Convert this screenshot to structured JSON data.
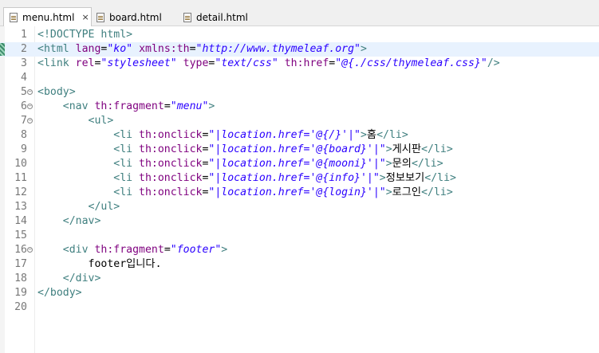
{
  "tabs": [
    {
      "label": "menu.html",
      "active": true,
      "close": "×"
    },
    {
      "label": "board.html",
      "active": false
    },
    {
      "label": "detail.html",
      "active": false
    }
  ],
  "colors": {
    "tag": "#3f7f7f",
    "attr": "#7f007f",
    "value": "#2a00ff",
    "text": "#000000",
    "line_number": "#787878",
    "highlight": "#e8f2fe"
  },
  "editor": {
    "lines": [
      {
        "n": "1",
        "fold": false,
        "segments": [
          [
            "t",
            "<!DOCTYPE html>"
          ]
        ]
      },
      {
        "n": "2",
        "fold": false,
        "segments": [
          [
            "t",
            "<html "
          ],
          [
            "a",
            "lang"
          ],
          [
            "x",
            "="
          ],
          [
            "v",
            "\"ko\""
          ],
          [
            "a",
            " xmlns:th"
          ],
          [
            "x",
            "="
          ],
          [
            "v",
            "\"http://www.thymeleaf.org\""
          ],
          [
            "t",
            ">"
          ]
        ]
      },
      {
        "n": "3",
        "fold": false,
        "segments": [
          [
            "t",
            "<link "
          ],
          [
            "a",
            "rel"
          ],
          [
            "x",
            "="
          ],
          [
            "v",
            "\"stylesheet\""
          ],
          [
            "a",
            " type"
          ],
          [
            "x",
            "="
          ],
          [
            "v",
            "\"text/css\""
          ],
          [
            "a",
            " th:href"
          ],
          [
            "x",
            "="
          ],
          [
            "v",
            "\"@{./css/thymeleaf.css}\""
          ],
          [
            "t",
            "/>"
          ]
        ]
      },
      {
        "n": "4",
        "fold": false,
        "segments": []
      },
      {
        "n": "5",
        "fold": true,
        "segments": [
          [
            "t",
            "<body>"
          ]
        ]
      },
      {
        "n": "6",
        "fold": true,
        "segments": [
          [
            "x",
            "    "
          ],
          [
            "t",
            "<nav "
          ],
          [
            "a",
            "th:fragment"
          ],
          [
            "x",
            "="
          ],
          [
            "v",
            "\"menu\""
          ],
          [
            "t",
            ">"
          ]
        ]
      },
      {
        "n": "7",
        "fold": true,
        "segments": [
          [
            "x",
            "        "
          ],
          [
            "t",
            "<ul>"
          ]
        ]
      },
      {
        "n": "8",
        "fold": false,
        "segments": [
          [
            "x",
            "            "
          ],
          [
            "t",
            "<li "
          ],
          [
            "a",
            "th:onclick"
          ],
          [
            "x",
            "="
          ],
          [
            "v",
            "\"|location.href='@{/}'|\""
          ],
          [
            "t",
            ">"
          ],
          [
            "b",
            "홈"
          ],
          [
            "t",
            "</li>"
          ]
        ]
      },
      {
        "n": "9",
        "fold": false,
        "segments": [
          [
            "x",
            "            "
          ],
          [
            "t",
            "<li "
          ],
          [
            "a",
            "th:onclick"
          ],
          [
            "x",
            "="
          ],
          [
            "v",
            "\"|location.href='@{board}'|\""
          ],
          [
            "t",
            ">"
          ],
          [
            "b",
            "게시판"
          ],
          [
            "t",
            "</li>"
          ]
        ]
      },
      {
        "n": "10",
        "fold": false,
        "segments": [
          [
            "x",
            "            "
          ],
          [
            "t",
            "<li "
          ],
          [
            "a",
            "th:onclick"
          ],
          [
            "x",
            "="
          ],
          [
            "v",
            "\"|location.href='@{mooni}'|\""
          ],
          [
            "t",
            ">"
          ],
          [
            "b",
            "문의"
          ],
          [
            "t",
            "</li>"
          ]
        ]
      },
      {
        "n": "11",
        "fold": false,
        "segments": [
          [
            "x",
            "            "
          ],
          [
            "t",
            "<li "
          ],
          [
            "a",
            "th:onclick"
          ],
          [
            "x",
            "="
          ],
          [
            "v",
            "\"|location.href='@{info}'|\""
          ],
          [
            "t",
            ">"
          ],
          [
            "b",
            "정보보기"
          ],
          [
            "t",
            "</li>"
          ]
        ]
      },
      {
        "n": "12",
        "fold": false,
        "segments": [
          [
            "x",
            "            "
          ],
          [
            "t",
            "<li "
          ],
          [
            "a",
            "th:onclick"
          ],
          [
            "x",
            "="
          ],
          [
            "v",
            "\"|location.href='@{login}'|\""
          ],
          [
            "t",
            ">"
          ],
          [
            "b",
            "로그인"
          ],
          [
            "t",
            "</li>"
          ]
        ]
      },
      {
        "n": "13",
        "fold": false,
        "segments": [
          [
            "x",
            "        "
          ],
          [
            "t",
            "</ul>"
          ]
        ]
      },
      {
        "n": "14",
        "fold": false,
        "segments": [
          [
            "x",
            "    "
          ],
          [
            "t",
            "</nav>"
          ]
        ]
      },
      {
        "n": "15",
        "fold": false,
        "segments": []
      },
      {
        "n": "16",
        "fold": true,
        "segments": [
          [
            "x",
            "    "
          ],
          [
            "t",
            "<div "
          ],
          [
            "a",
            "th:fragment"
          ],
          [
            "x",
            "="
          ],
          [
            "v",
            "\"footer\""
          ],
          [
            "t",
            ">"
          ]
        ]
      },
      {
        "n": "17",
        "fold": false,
        "segments": [
          [
            "x",
            "        "
          ],
          [
            "b",
            "footer입니다."
          ]
        ]
      },
      {
        "n": "18",
        "fold": false,
        "segments": [
          [
            "x",
            "    "
          ],
          [
            "t",
            "</div>"
          ]
        ]
      },
      {
        "n": "19",
        "fold": false,
        "segments": [
          [
            "t",
            "</body>"
          ]
        ]
      },
      {
        "n": "20",
        "fold": false,
        "segments": []
      }
    ]
  }
}
